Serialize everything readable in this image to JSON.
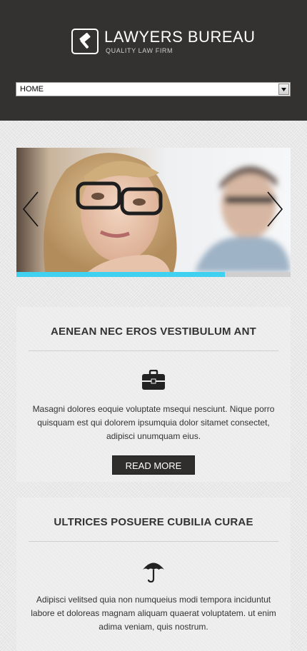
{
  "logo": {
    "title": "LAWYERS BUREAU",
    "subtitle": "QUALITY LAW FIRM",
    "icon": "gavel-icon"
  },
  "nav": {
    "selected": "HOME"
  },
  "slider": {
    "progress": 0.76,
    "prev_icon": "chevron-left-icon",
    "next_icon": "chevron-right-icon"
  },
  "cards": [
    {
      "title": "AENEAN NEC EROS VESTIBULUM ANT",
      "icon": "briefcase-icon",
      "text": "Masagni dolores eoquie voluptate msequi nesciunt. Nique porro quisquam est qui dolorem ipsumquia dolor sitamet consectet, adipisci unumquam eius.",
      "button": "READ MORE"
    },
    {
      "title": "ULTRICES POSUERE CUBILIA CURAE",
      "icon": "umbrella-icon",
      "text": "Adipisci velitsed quia non numqueius modi tempora inciduntut labore et doloreas magnam aliquam quaerat voluptatem. ut enim adima veniam, quis nostrum."
    }
  ],
  "colors": {
    "header_bg": "#333230",
    "accent": "#3fd1ef",
    "button_bg": "#2f2e2c",
    "page_bg": "#e9e9e9"
  }
}
